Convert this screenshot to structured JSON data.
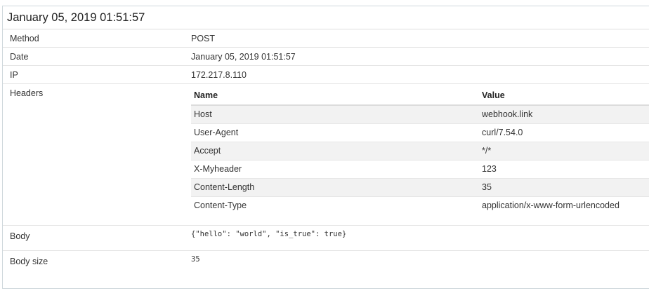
{
  "request": {
    "title": "January 05, 2019 01:51:57",
    "fields": {
      "method_label": "Method",
      "method_value": "POST",
      "date_label": "Date",
      "date_value": "January 05, 2019 01:51:57",
      "ip_label": "IP",
      "ip_value": "172.217.8.110",
      "headers_label": "Headers",
      "body_label": "Body",
      "body_value": "{\"hello\": \"world\", \"is_true\": true}",
      "body_size_label": "Body size",
      "body_size_value": "35"
    },
    "headers_table": {
      "columns": [
        "Name",
        "Value"
      ],
      "rows": [
        {
          "name": "Host",
          "value": "webhook.link"
        },
        {
          "name": "User-Agent",
          "value": "curl/7.54.0"
        },
        {
          "name": "Accept",
          "value": "*/*"
        },
        {
          "name": "X-Myheader",
          "value": "123"
        },
        {
          "name": "Content-Length",
          "value": "35"
        },
        {
          "name": "Content-Type",
          "value": "application/x-www-form-urlencoded"
        }
      ]
    }
  }
}
